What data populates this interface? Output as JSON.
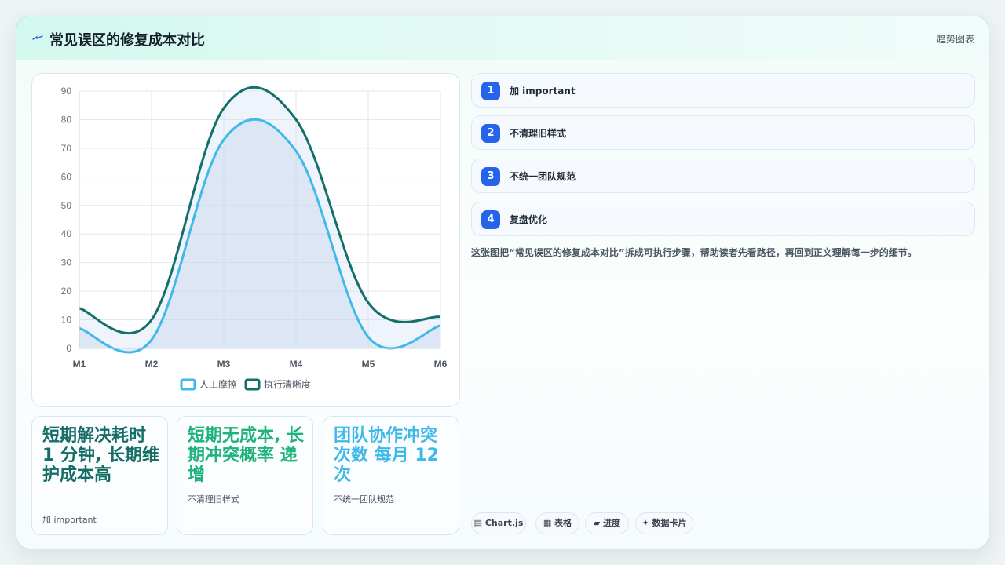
{
  "header": {
    "title": "常见误区的修复成本对比",
    "right_label": "趋势图表"
  },
  "chart_data": {
    "type": "area",
    "categories": [
      "M1",
      "M2",
      "M3",
      "M4",
      "M5",
      "M6"
    ],
    "ylim": [
      0,
      90
    ],
    "yticks": [
      0,
      10,
      20,
      30,
      40,
      50,
      60,
      70,
      80,
      90
    ],
    "grid": true,
    "legend_position": "bottom",
    "series": [
      {
        "name": "人工摩擦",
        "values": [
          7,
          3,
          73,
          69,
          4,
          8
        ],
        "color": "#3fb9e8"
      },
      {
        "name": "执行清晰度",
        "values": [
          14,
          10,
          84,
          80,
          16,
          11
        ],
        "color": "#137069"
      }
    ]
  },
  "stats": [
    {
      "big": "短期解决耗时 1 分钟, 长期维护成本高",
      "sub": "加 important",
      "color": "#146e66"
    },
    {
      "big": "短期无成本, 长期冲突概率 递增",
      "sub": "不清理旧样式",
      "color": "#1db37a"
    },
    {
      "big": "团队协作冲突次数 每月 12 次",
      "sub": "不统一团队规范",
      "color": "#3fb9e8"
    }
  ],
  "steps": [
    {
      "num": "1",
      "label": "加 important"
    },
    {
      "num": "2",
      "label": "不清理旧样式"
    },
    {
      "num": "3",
      "label": "不统一团队规范"
    },
    {
      "num": "4",
      "label": "复盘优化"
    }
  ],
  "description": "这张图把“常见误区的修复成本对比”拆成可执行步骤，帮助读者先看路径，再回到正文理解每一步的细节。",
  "tags": [
    {
      "icon": "▤",
      "label": "Chart.js"
    },
    {
      "icon": "▦",
      "label": "表格"
    },
    {
      "icon": "▰",
      "label": "进度"
    },
    {
      "icon": "✦",
      "label": "数据卡片"
    }
  ],
  "colors": {
    "accent": "#2563eb",
    "brand": "#137069",
    "card_border": "#b9ecdf"
  }
}
